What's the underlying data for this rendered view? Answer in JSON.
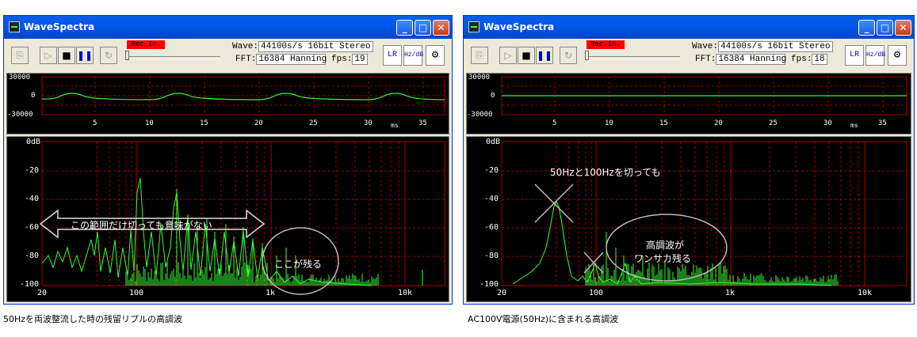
{
  "left": {
    "window_title": "WaveSpectra",
    "rec_label": "Rec.In.",
    "wave_label": "Wave:",
    "wave_value": "44100s/s 16bit Stereo",
    "fft_label": "FFT:",
    "fft_value": "16384 Hanning",
    "fps_label": "fps:",
    "fps_value": "19",
    "scope_y_ticks": [
      "30000",
      "0",
      "-30000"
    ],
    "scope_x_ticks": [
      "5",
      "10",
      "15",
      "20",
      "25",
      "30",
      "35"
    ],
    "scope_unit": "ms",
    "spec_y_ticks": [
      "0dB",
      "-20",
      "-40",
      "-60",
      "-80",
      "-100"
    ],
    "spec_x_ticks": [
      "20",
      "100",
      "1k",
      "10k"
    ],
    "arrow_text": "この範囲だけ切っても意味がない",
    "ellipse_text": "ここが残る",
    "caption": "50Hzを両波整流した時の残留リプルの高調波"
  },
  "right": {
    "window_title": "WaveSpectra",
    "rec_label": "Rec.In.",
    "wave_label": "Wave:",
    "wave_value": "44100s/s 16bit Stereo",
    "fft_label": "FFT:",
    "fft_value": "16384 Hanning",
    "fps_label": "fps:",
    "fps_value": "18",
    "scope_y_ticks": [
      "30000",
      "0",
      "-30000"
    ],
    "scope_x_ticks": [
      "5",
      "10",
      "15",
      "20",
      "25",
      "30",
      "35"
    ],
    "scope_unit": "ms",
    "spec_y_ticks": [
      "0dB",
      "-20",
      "-40",
      "-60",
      "-80",
      "-100"
    ],
    "spec_x_ticks": [
      "20",
      "100",
      "1k",
      "10k"
    ],
    "cut_text": "50Hzと100Hzを切っても",
    "ellipse_text_1": "高調波が",
    "ellipse_text_2": "ワンサカ残る",
    "caption": "AC100V電源(50Hz)に含まれる高調波"
  },
  "icons": {
    "open": "folder-icon",
    "play": "play-icon",
    "stop": "stop-icon",
    "pause": "pause-icon",
    "loop": "loop-icon",
    "lr": "lr-icon",
    "hzdb": "hz-db-icon",
    "settings": "wrench-icon"
  },
  "colors": {
    "trace": "#33ff33",
    "grid": "#a00000",
    "rec": "#ff0000",
    "titlebar": "#0058ee"
  }
}
